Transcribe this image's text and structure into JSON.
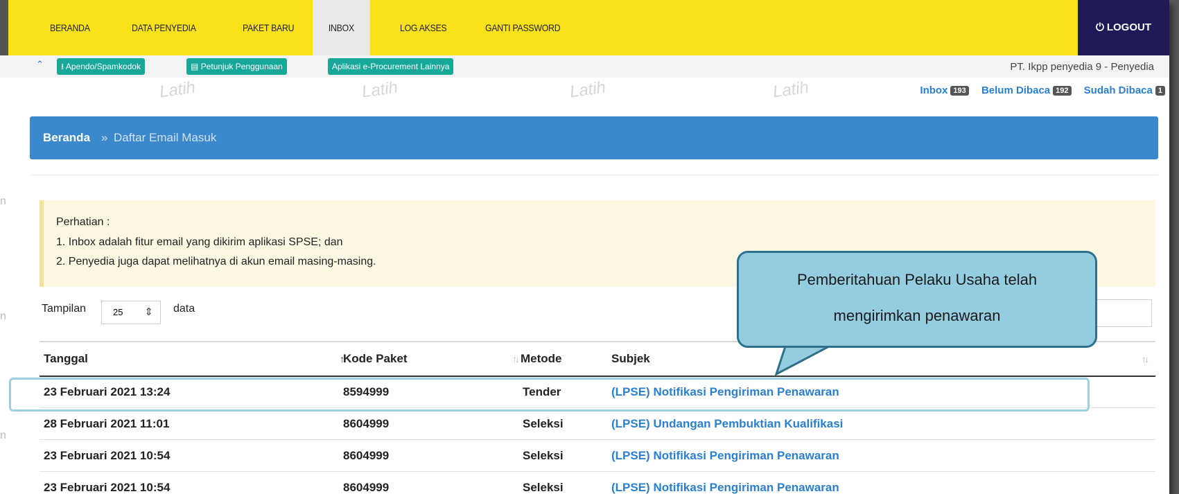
{
  "nav": {
    "items": [
      {
        "label": "BERANDA"
      },
      {
        "label": "DATA PENYEDIA"
      },
      {
        "label": "PAKET BARU"
      },
      {
        "label": "INBOX"
      },
      {
        "label": "LOG AKSES"
      },
      {
        "label": "GANTI PASSWORD"
      }
    ],
    "logout_label": "LOGOUT",
    "logout_icon": "power-icon"
  },
  "subbar": {
    "buttons": [
      {
        "label": "Apendo/Spamkodok",
        "icon": "download-icon"
      },
      {
        "label": "Petunjuk Penggunaan",
        "icon": "book-icon"
      },
      {
        "label": "Aplikasi e-Procurement Lainnya"
      }
    ],
    "company": "PT. Ikpp penyedia 9 - Penyedia",
    "watermark": "Latih"
  },
  "counts": {
    "inbox_label": "Inbox",
    "inbox": "193",
    "unread_label": "Belum Dibaca",
    "unread": "192",
    "read_label": "Sudah Dibaca",
    "read": "1"
  },
  "breadcrumb": {
    "home": "Beranda",
    "sep": "»",
    "current": "Daftar Email Masuk"
  },
  "alert": {
    "title": "Perhatian :",
    "line1": "1. Inbox adalah fitur email yang dikirim aplikasi SPSE; dan",
    "line2": "2. Penyedia juga dapat melihatnya di akun email masing-masing."
  },
  "length": {
    "prefix": "Tampilan",
    "value": "25",
    "suffix": "data"
  },
  "table": {
    "headers": [
      "Tanggal",
      "Kode Paket",
      "Metode",
      "Subjek"
    ],
    "rows": [
      {
        "tanggal": "23 Februari 2021 13:24",
        "kode": "8594999",
        "metode": "Tender",
        "subjek": "(LPSE) Notifikasi Pengiriman Penawaran"
      },
      {
        "tanggal": "28 Februari 2021 11:01",
        "kode": "8604999",
        "metode": "Seleksi",
        "subjek": "(LPSE) Undangan Pembuktian Kualifikasi"
      },
      {
        "tanggal": "23 Februari 2021 10:54",
        "kode": "8604999",
        "metode": "Seleksi",
        "subjek": "(LPSE) Notifikasi Pengiriman Penawaran"
      },
      {
        "tanggal": "23 Februari 2021 10:54",
        "kode": "8604999",
        "metode": "Seleksi",
        "subjek": "(LPSE) Notifikasi Pengiriman Penawaran"
      }
    ]
  },
  "callout": {
    "line1": "Pemberitahuan Pelaku Usaha telah",
    "line2": "mengirimkan penawaran"
  },
  "colors": {
    "nav_bg": "#f9e21a",
    "logout_bg": "#1f1a57",
    "teal": "#17a89a",
    "crumb_bg": "#3b88cc",
    "link": "#2a7fd0",
    "callout_bg": "#94cde0"
  }
}
